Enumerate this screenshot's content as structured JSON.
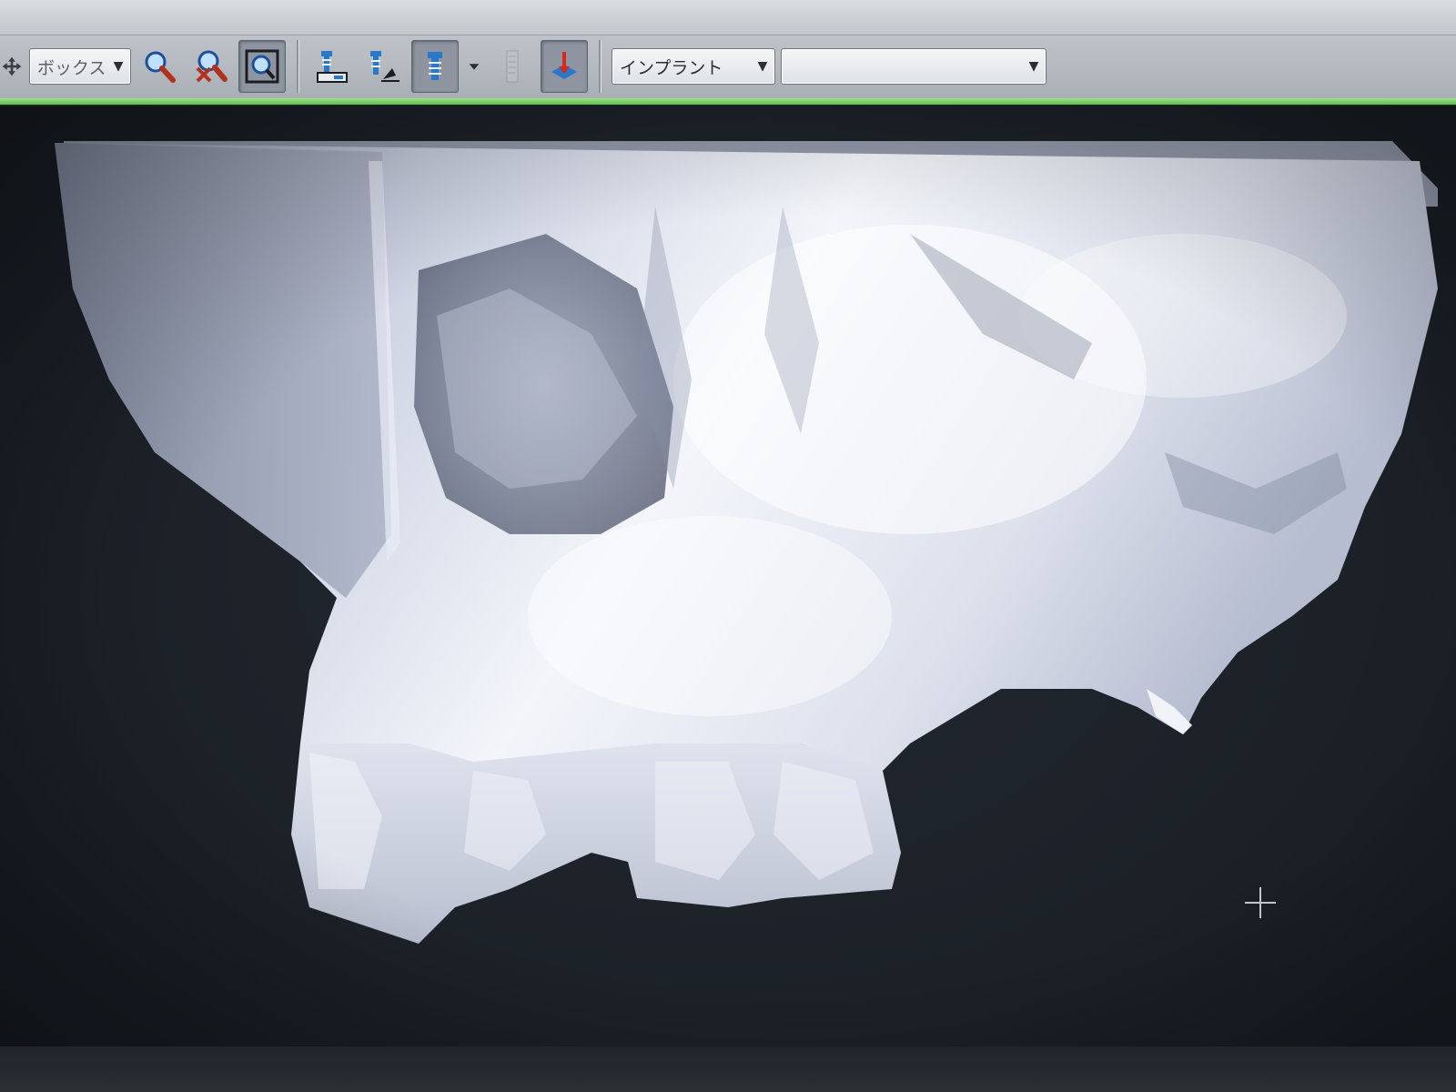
{
  "toolbar": {
    "mode_combo": {
      "value": "ボックス"
    },
    "icons": {
      "move": "move-icon",
      "zoom_in": "zoom-in-icon",
      "zoom_out": "zoom-out-icon",
      "zoom_fit": "zoom-fit-icon",
      "implant_place": "implant-place-icon",
      "implant_tilt": "implant-tilt-icon",
      "implant_select": "implant-select-icon",
      "implant_dropdown": "chevron-down-icon",
      "spacer": "ruler-icon",
      "axis": "axis-icon"
    },
    "implant_combo": {
      "value": "インプラント"
    },
    "implant_model_combo": {
      "value": ""
    }
  },
  "colors": {
    "toolbar_bg": "#b7bbc2",
    "accent": "#6ccb58",
    "viewport_bg": "#1c2128",
    "bone": "#e9ecf4",
    "bone_shadow": "#7f879c"
  }
}
